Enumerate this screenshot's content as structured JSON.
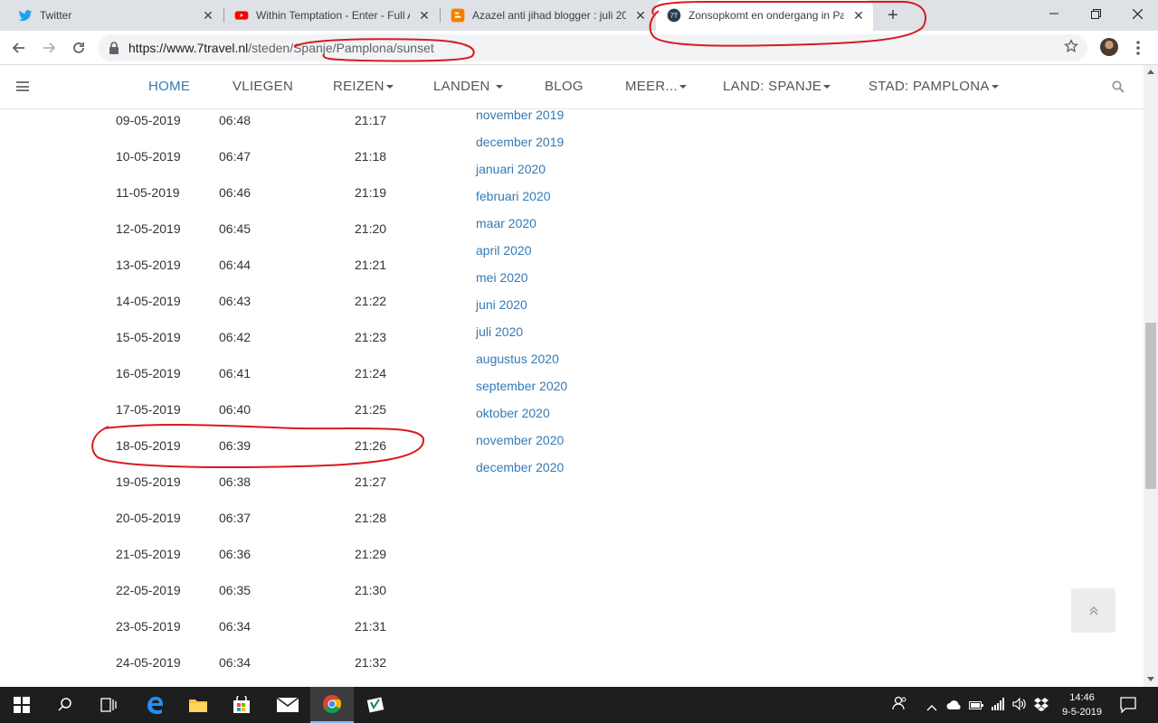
{
  "browser": {
    "tabs": [
      {
        "title": "Twitter",
        "icon": "twitter-icon"
      },
      {
        "title": "Within Temptation - Enter - Full A",
        "icon": "youtube-icon"
      },
      {
        "title": "Azazel anti jihad blogger : juli 20",
        "icon": "blogger-icon"
      },
      {
        "title": "Zonsopkomt en ondergang in Pa",
        "icon": "7travel-icon",
        "active": true
      }
    ],
    "close_glyph": "✕",
    "new_tab_glyph": "+",
    "url_host": "https://www.7travel.nl",
    "url_path": "/steden/Spanje/Pamplona/sunset"
  },
  "site": {
    "logo_text": "7T",
    "nav": [
      {
        "label": "HOME",
        "active": true
      },
      {
        "label": "VLIEGEN"
      },
      {
        "label": "REIZEN",
        "dropdown": true
      },
      {
        "label": "LANDEN",
        "dropdown": true
      },
      {
        "label": "BLOG"
      },
      {
        "label": "MEER...",
        "dropdown": true
      },
      {
        "label": "LAND: SPANJE",
        "dropdown": true
      },
      {
        "label": "STAD: PAMPLONA",
        "dropdown": true
      }
    ]
  },
  "table": {
    "rows": [
      {
        "date": "09-05-2019",
        "sunrise": "06:48",
        "sunset": "21:17"
      },
      {
        "date": "10-05-2019",
        "sunrise": "06:47",
        "sunset": "21:18"
      },
      {
        "date": "11-05-2019",
        "sunrise": "06:46",
        "sunset": "21:19"
      },
      {
        "date": "12-05-2019",
        "sunrise": "06:45",
        "sunset": "21:20"
      },
      {
        "date": "13-05-2019",
        "sunrise": "06:44",
        "sunset": "21:21"
      },
      {
        "date": "14-05-2019",
        "sunrise": "06:43",
        "sunset": "21:22"
      },
      {
        "date": "15-05-2019",
        "sunrise": "06:42",
        "sunset": "21:23"
      },
      {
        "date": "16-05-2019",
        "sunrise": "06:41",
        "sunset": "21:24"
      },
      {
        "date": "17-05-2019",
        "sunrise": "06:40",
        "sunset": "21:25"
      },
      {
        "date": "18-05-2019",
        "sunrise": "06:39",
        "sunset": "21:26"
      },
      {
        "date": "19-05-2019",
        "sunrise": "06:38",
        "sunset": "21:27"
      },
      {
        "date": "20-05-2019",
        "sunrise": "06:37",
        "sunset": "21:28"
      },
      {
        "date": "21-05-2019",
        "sunrise": "06:36",
        "sunset": "21:29"
      },
      {
        "date": "22-05-2019",
        "sunrise": "06:35",
        "sunset": "21:30"
      },
      {
        "date": "23-05-2019",
        "sunrise": "06:34",
        "sunset": "21:31"
      },
      {
        "date": "24-05-2019",
        "sunrise": "06:34",
        "sunset": "21:32"
      }
    ]
  },
  "months": [
    "november 2019",
    "december 2019",
    "januari 2020",
    "februari 2020",
    "maar 2020",
    "april 2020",
    "mei 2020",
    "juni 2020",
    "juli 2020",
    "augustus 2020",
    "september 2020",
    "oktober 2020",
    "november 2020",
    "december 2020"
  ],
  "taskbar": {
    "time": "14:46",
    "date": "9-5-2019"
  },
  "colors": {
    "link": "#337ab7",
    "annotation": "#d9191f",
    "taskbar": "#1e1e1e"
  }
}
